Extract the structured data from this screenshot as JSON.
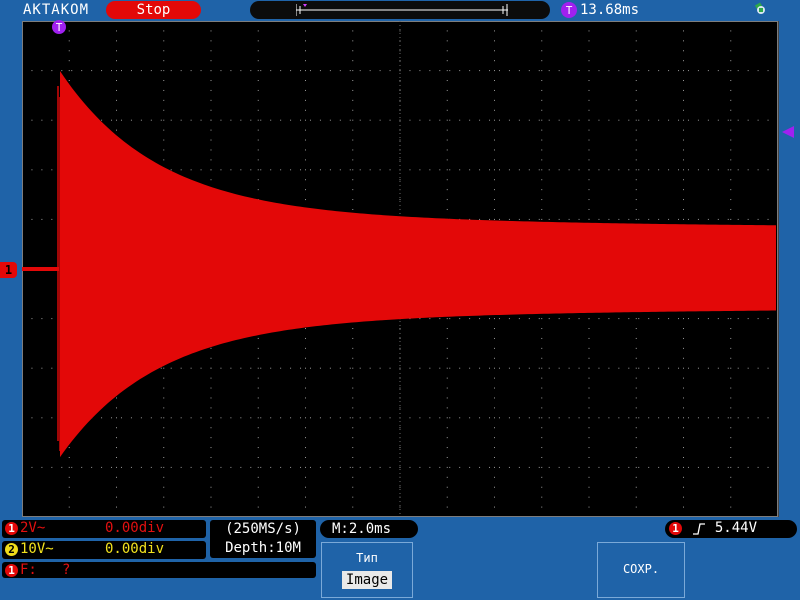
{
  "header": {
    "brand": "AKTAKOM",
    "run_state": "Stop",
    "trigger_time": "13.68ms",
    "trigger_pos_marker": "T"
  },
  "channels": {
    "ch1_marker": "1",
    "ch1": {
      "num": "1",
      "scale": "2V~",
      "offset": "0.00div"
    },
    "ch2": {
      "num": "2",
      "scale": "10V~",
      "offset": "0.00div"
    }
  },
  "measurements": {
    "freq_label": "F:",
    "freq_value": "?"
  },
  "acquisition": {
    "sample_rate": "(250MS/s)",
    "depth": "Depth:10M"
  },
  "timebase": {
    "value": "M:2.0ms"
  },
  "trigger": {
    "num": "1",
    "level": "5.44V"
  },
  "menu": {
    "type_label": "Тип",
    "type_value": "Image",
    "save_label": "СОХР."
  },
  "colors": {
    "ch1": "#e30808",
    "ch2": "#f0dc1a",
    "panel": "#1f63a8",
    "screen": "#000000",
    "trigger_marker": "#a020f0"
  },
  "icons": {
    "usb": "usb-icon",
    "trigger_edge": "rising-edge-icon"
  }
}
